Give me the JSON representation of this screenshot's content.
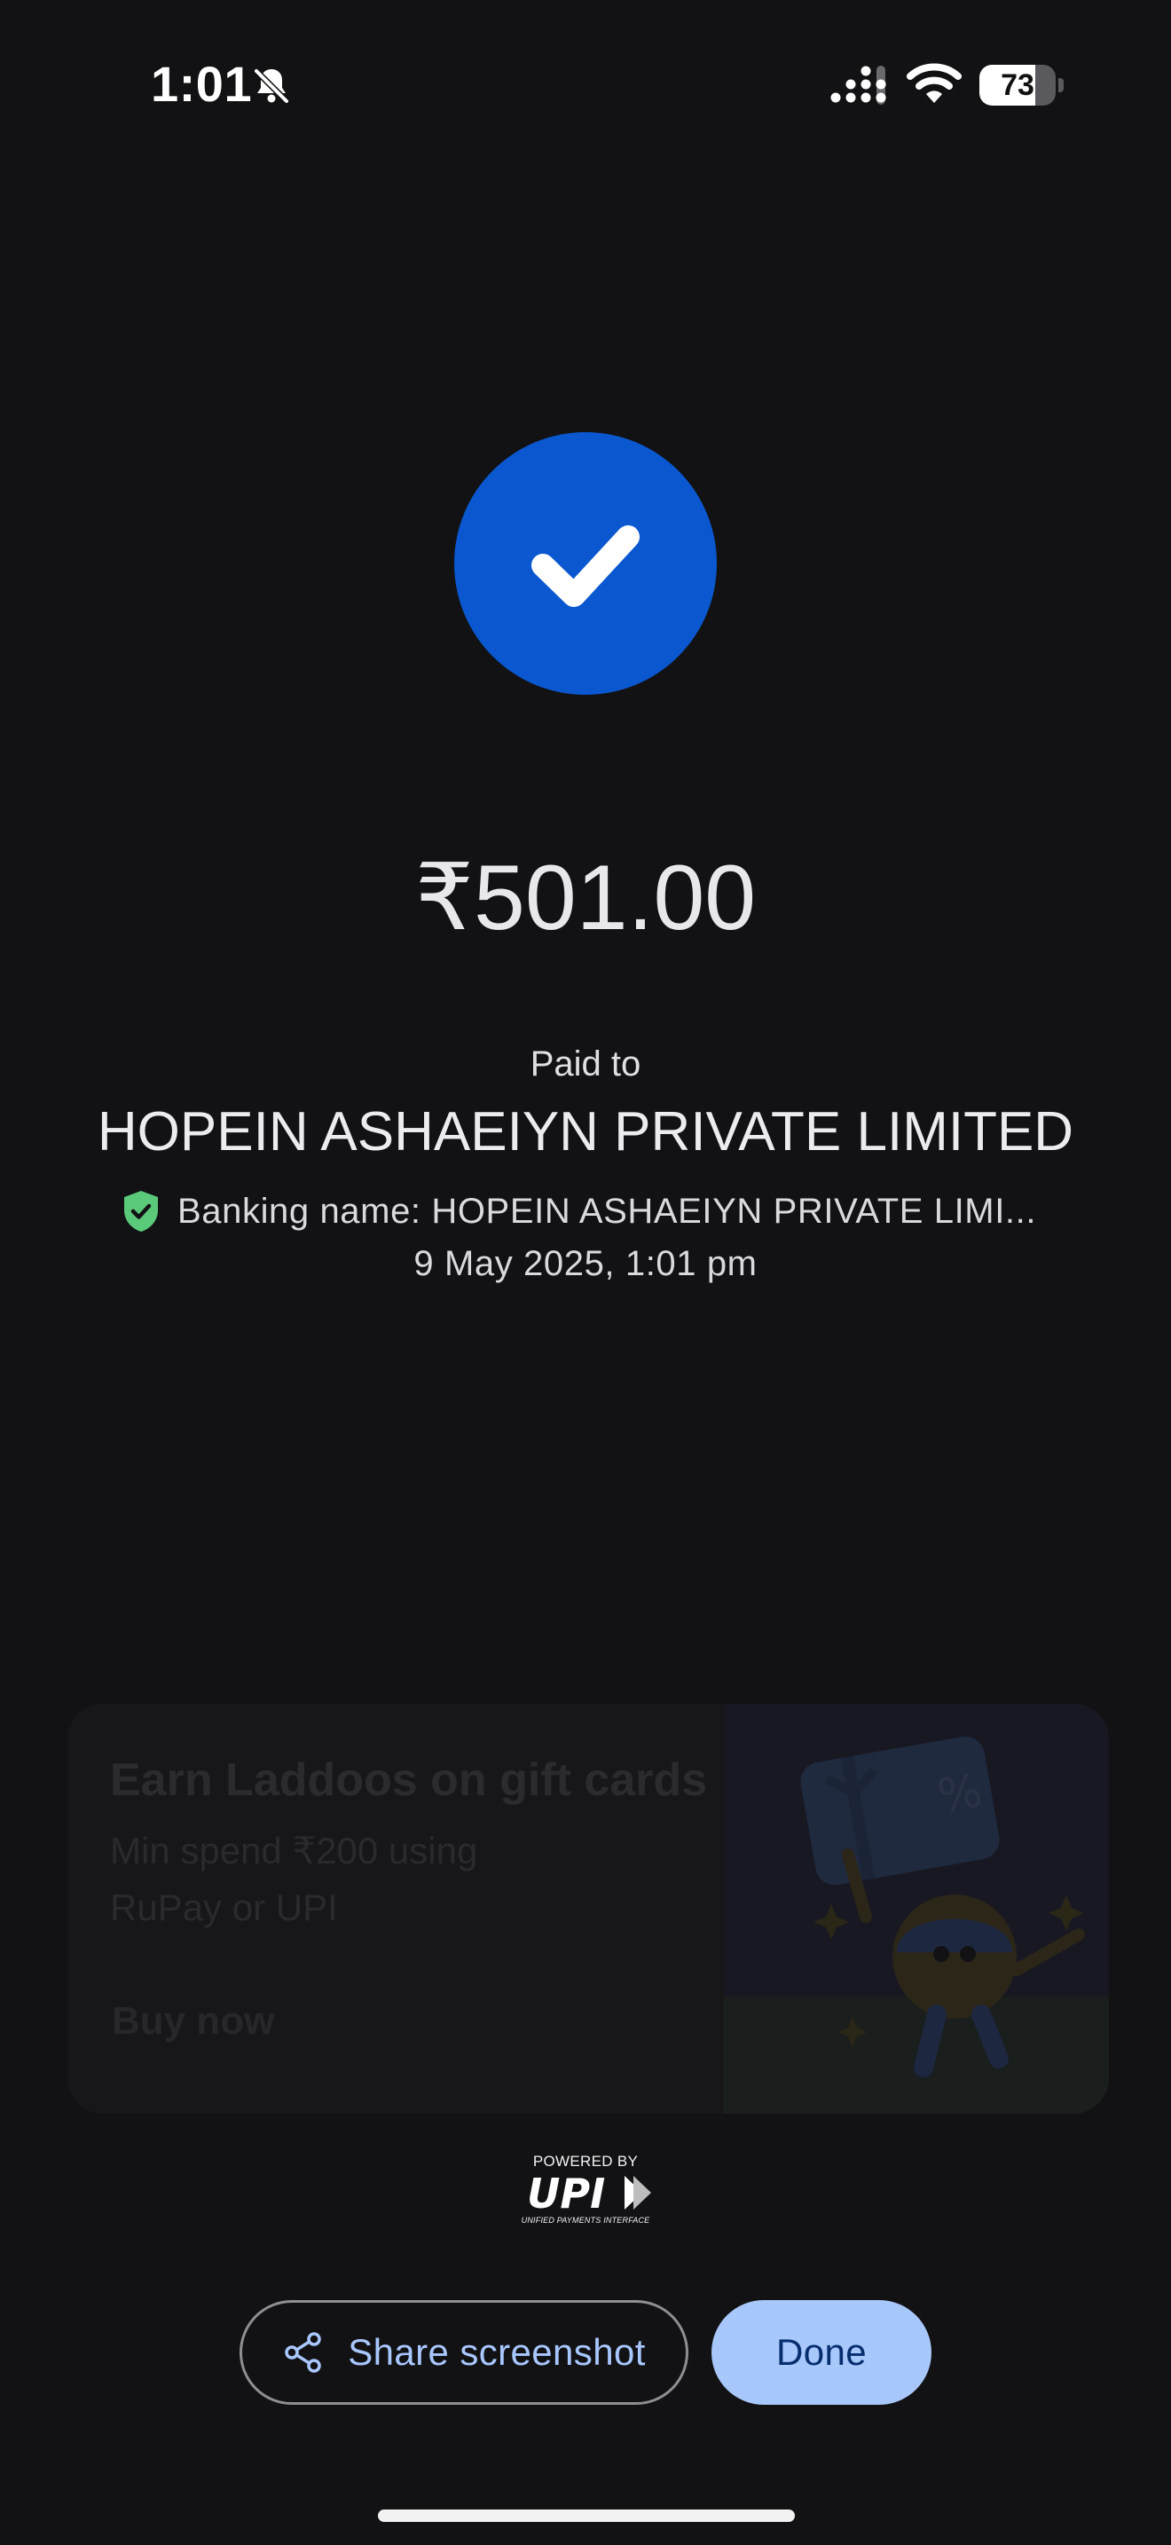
{
  "status_bar": {
    "time": "1:01",
    "battery_level": "73",
    "battery_fraction": 0.73,
    "icons": [
      "bell-slash-icon",
      "cellular-signal-icon",
      "wifi-icon",
      "battery-icon"
    ]
  },
  "payment": {
    "status_icon": "check-icon",
    "amount": "₹501.00",
    "paid_to_label": "Paid to",
    "payee_name": "HOPEIN ASHAEIYN PRIVATE LIMITED",
    "banking_name_text": "Banking name: HOPEIN ASHAEIYN PRIVATE LIMI...",
    "verified_icon": "shield-check-icon",
    "date_time": "9 May 2025, 1:01 pm"
  },
  "promo": {
    "title": "Earn Laddoos on gift cards",
    "subtitle": "Min spend ₹200 using RuPay or UPI",
    "cta": "Buy now",
    "illustration_badge": "%"
  },
  "upi": {
    "powered_by": "POWERED BY",
    "wordmark": "UPI",
    "full_name": "UNIFIED PAYMENTS INTERFACE"
  },
  "actions": {
    "share_label": "Share screenshot",
    "share_icon": "share-icon",
    "done_label": "Done"
  },
  "colors": {
    "background": "#121214",
    "check_circle": "#0a57d0",
    "verified_green": "#5bc97a",
    "done_button_bg": "#a8c7fa",
    "done_button_text": "#062e6f",
    "share_text": "#a9c7ff"
  }
}
